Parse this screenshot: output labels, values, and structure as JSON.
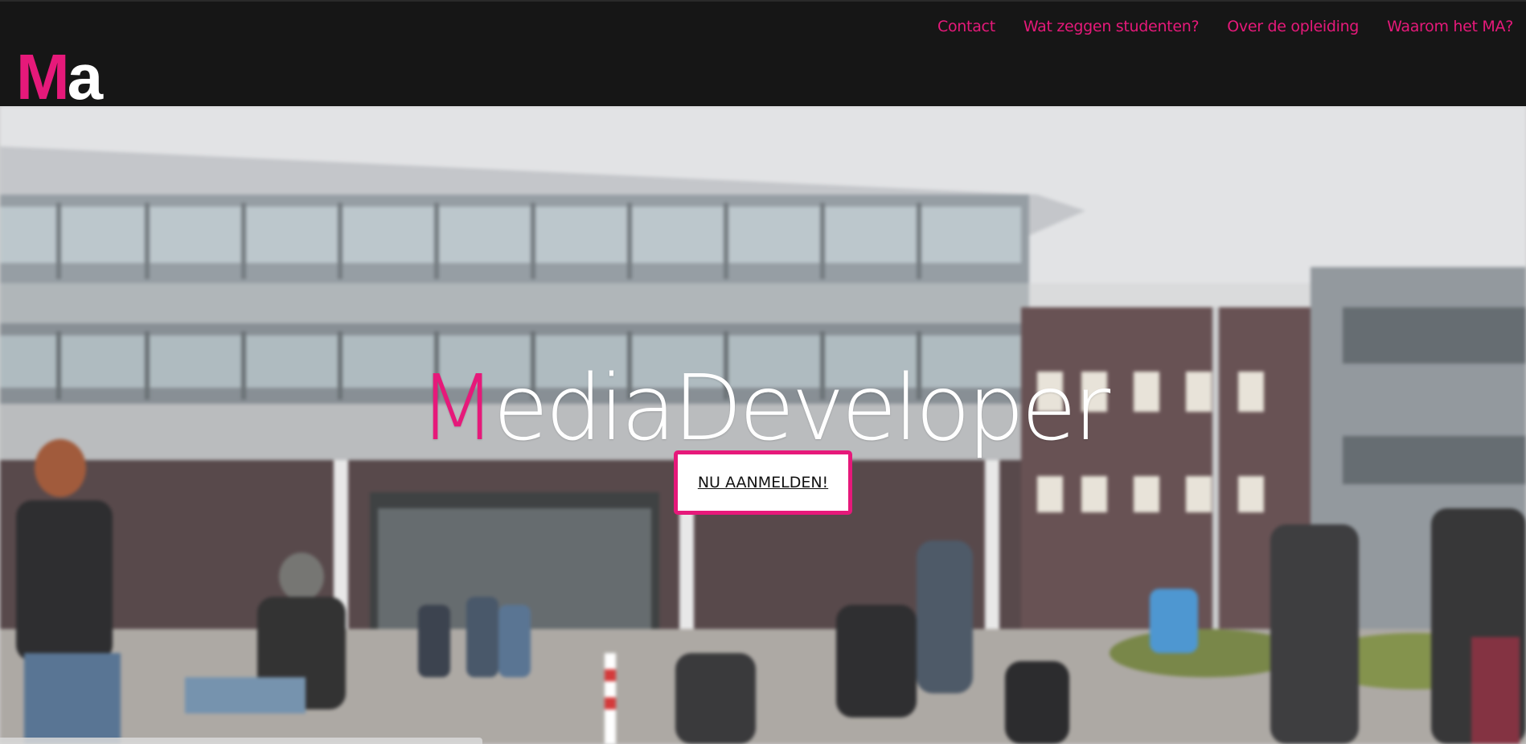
{
  "site": {
    "logo_m": "M",
    "logo_rest": "a"
  },
  "nav": {
    "items": [
      "Contact",
      "Wat zeggen studenten?",
      "Over de opleiding",
      "Waarom het MA?"
    ]
  },
  "hero": {
    "title_first": "M",
    "title_rest": "ediaDeveloper",
    "cta_label": "NU AANMELDEN!"
  },
  "colors": {
    "accent": "#e6197a",
    "header_bg": "#161616"
  }
}
